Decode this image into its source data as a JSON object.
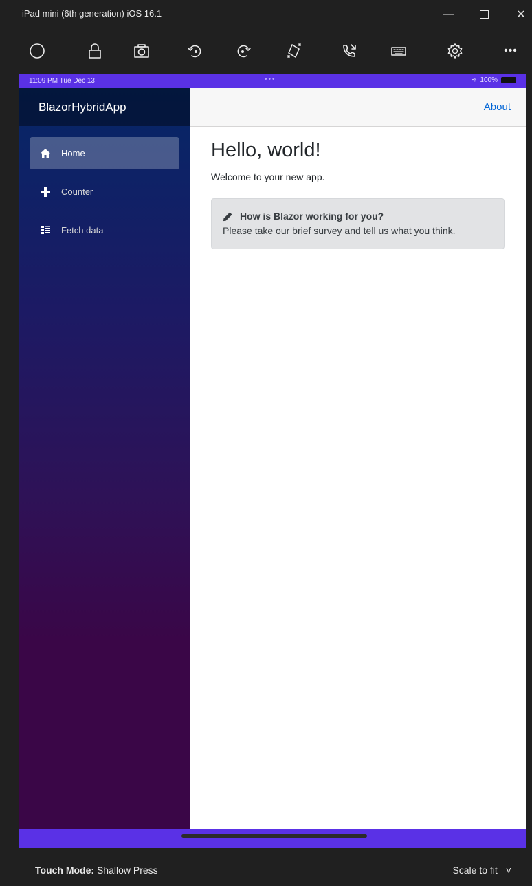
{
  "window": {
    "title": "iPad mini (6th generation) iOS 16.1",
    "minimize_glyph": "—",
    "maximize_glyph": "☐",
    "close_glyph": "✕"
  },
  "toolbar": {
    "icons": [
      "home-icon",
      "lock-icon",
      "screenshot-icon",
      "rotate-left-icon",
      "rotate-right-icon",
      "shake-icon",
      "call-icon",
      "keyboard-icon",
      "settings-icon",
      "more-icon"
    ],
    "more_glyph": "•••"
  },
  "status": {
    "time": "11:09 PM  Tue Dec 13",
    "dots": "•••",
    "battery": "100%",
    "wifi_glyph": "≋"
  },
  "app": {
    "brand": "BlazorHybridApp",
    "about": "About",
    "nav": [
      {
        "label": "Home",
        "icon": "home-icon",
        "active": true
      },
      {
        "label": "Counter",
        "icon": "plus-icon",
        "active": false
      },
      {
        "label": "Fetch data",
        "icon": "list-icon",
        "active": false
      }
    ],
    "heading": "Hello, world!",
    "welcome": "Welcome to your new app.",
    "survey": {
      "title": "How is Blazor working for you?",
      "prefix": "Please take our ",
      "link": "brief survey",
      "suffix": " and tell us what you think."
    }
  },
  "bottom": {
    "touch_label": "Touch Mode:",
    "touch_value": "Shallow Press",
    "scale": "Scale to fit",
    "scale_glyph": "˅"
  },
  "colors": {
    "device_frame": "#5a31e6",
    "link": "#0366d6",
    "sidebar_top": "#052767",
    "sidebar_bottom": "#3a0647"
  }
}
